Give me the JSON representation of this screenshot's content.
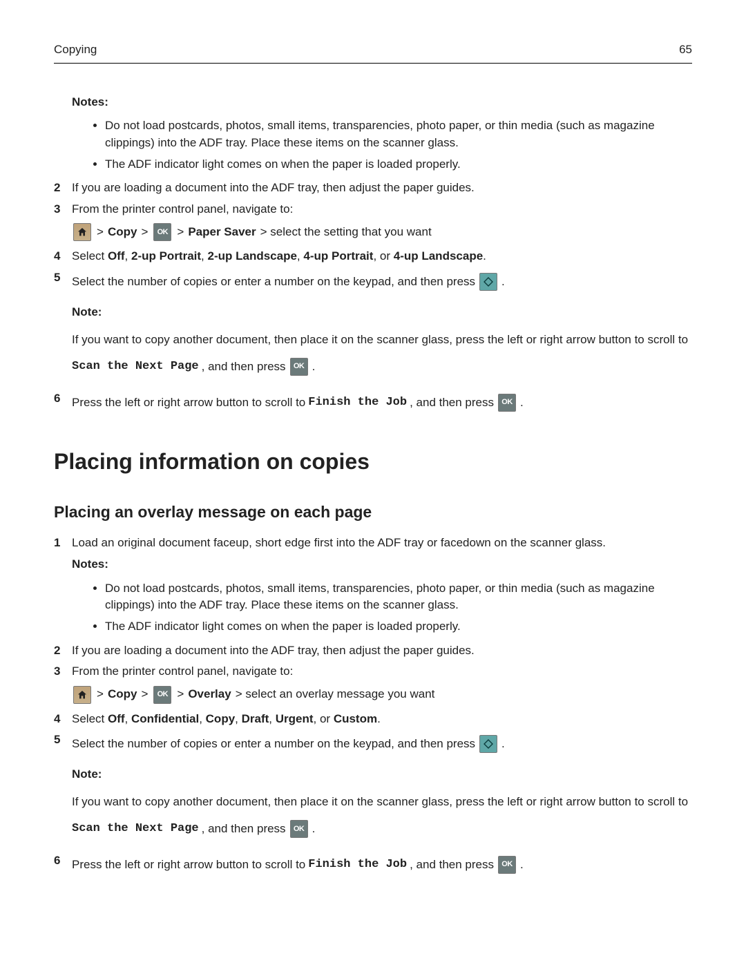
{
  "header": {
    "section": "Copying",
    "page_number": "65"
  },
  "icons": {
    "ok_label": "OK"
  },
  "block1": {
    "notes_label": "Notes:",
    "notes": [
      "Do not load postcards, photos, small items, transparencies, photo paper, or thin media (such as magazine clippings) into the ADF tray. Place these items on the scanner glass.",
      "The ADF indicator light comes on when the paper is loaded properly."
    ],
    "step2": "If you are loading a document into the ADF tray, then adjust the paper guides.",
    "step3": "From the printer control panel, navigate to:",
    "nav": {
      "sep": ">",
      "copy": "Copy",
      "paper_saver": "Paper Saver",
      "tail": " > select the setting that you want"
    },
    "step4_pre": "Select ",
    "step4_opts": {
      "off": "Off",
      "c": ", ",
      "p2": "2‑up Portrait",
      "l2": "2‑up Landscape",
      "p4": "4‑up Portrait",
      "or": ", or ",
      "l4": "4‑up Landscape",
      "end": "."
    },
    "step5_pre": "Select the number of copies or enter a number on the keypad, and then press ",
    "step5_end": ".",
    "step5_note_pre": "Note:",
    "step5_note_body1": " If you want to copy another document, then place it on the scanner glass, press the left or right arrow button to scroll to ",
    "step5_note_code": "Scan the Next Page",
    "step5_note_body2": ", and then press ",
    "step5_note_end": ".",
    "step6_pre": "Press the left or right arrow button to scroll to ",
    "step6_code": "Finish the Job",
    "step6_mid": ", and then press ",
    "step6_end": "."
  },
  "section2": {
    "title": "Placing information on copies",
    "subtitle": "Placing an overlay message on each page",
    "step1": "Load an original document faceup, short edge first into the ADF tray or facedown on the scanner glass.",
    "notes_label": "Notes:",
    "notes": [
      "Do not load postcards, photos, small items, transparencies, photo paper, or thin media (such as magazine clippings) into the ADF tray. Place these items on the scanner glass.",
      "The ADF indicator light comes on when the paper is loaded properly."
    ],
    "step2": "If you are loading a document into the ADF tray, then adjust the paper guides.",
    "step3": "From the printer control panel, navigate to:",
    "nav": {
      "sep": ">",
      "copy": "Copy",
      "overlay": "Overlay",
      "tail": " > select an overlay message you want"
    },
    "step4_pre": "Select ",
    "step4_opts": {
      "off": "Off",
      "c": ", ",
      "conf": "Confidential",
      "copy": "Copy",
      "draft": "Draft",
      "urgent": "Urgent",
      "or": ", or ",
      "custom": "Custom",
      "end": "."
    },
    "step5_pre": "Select the number of copies or enter a number on the keypad, and then press ",
    "step5_end": ".",
    "step5_note_pre": "Note:",
    "step5_note_body1": " If you want to copy another document, then place it on the scanner glass, press the left or right arrow button to scroll to ",
    "step5_note_code": "Scan the Next Page",
    "step5_note_body2": ", and then press ",
    "step5_note_end": ".",
    "step6_pre": "Press the left or right arrow button to scroll to ",
    "step6_code": "Finish the Job",
    "step6_mid": ", and then press ",
    "step6_end": "."
  }
}
